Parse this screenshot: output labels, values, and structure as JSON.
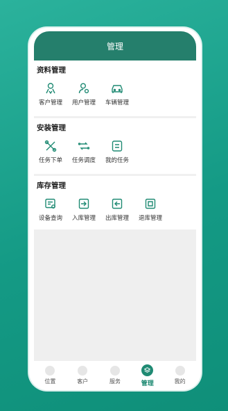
{
  "header": {
    "title": "管理"
  },
  "sections": [
    {
      "title": "资料管理",
      "items": [
        {
          "label": "客户管理",
          "icon": "customer-icon"
        },
        {
          "label": "用户管理",
          "icon": "user-gear-icon"
        },
        {
          "label": "车辆管理",
          "icon": "car-icon"
        }
      ]
    },
    {
      "title": "安装管理",
      "items": [
        {
          "label": "任务下单",
          "icon": "tools-icon"
        },
        {
          "label": "任务调度",
          "icon": "dispatch-icon"
        },
        {
          "label": "我的任务",
          "icon": "task-list-icon"
        }
      ]
    },
    {
      "title": "库存管理",
      "items": [
        {
          "label": "设备查询",
          "icon": "device-search-icon"
        },
        {
          "label": "入库管理",
          "icon": "stock-in-icon"
        },
        {
          "label": "出库管理",
          "icon": "stock-out-icon"
        },
        {
          "label": "退库管理",
          "icon": "stock-return-icon"
        }
      ]
    }
  ],
  "tabbar": [
    {
      "label": "位置",
      "icon": "location-icon",
      "active": false
    },
    {
      "label": "客户",
      "icon": "customer-tab-icon",
      "active": false
    },
    {
      "label": "服务",
      "icon": "service-icon",
      "active": false
    },
    {
      "label": "管理",
      "icon": "layers-icon",
      "active": true
    },
    {
      "label": "我的",
      "icon": "profile-icon",
      "active": false
    }
  ],
  "colors": {
    "accent": "#1f8a73",
    "header": "#257f6c",
    "background": "#149a85"
  }
}
